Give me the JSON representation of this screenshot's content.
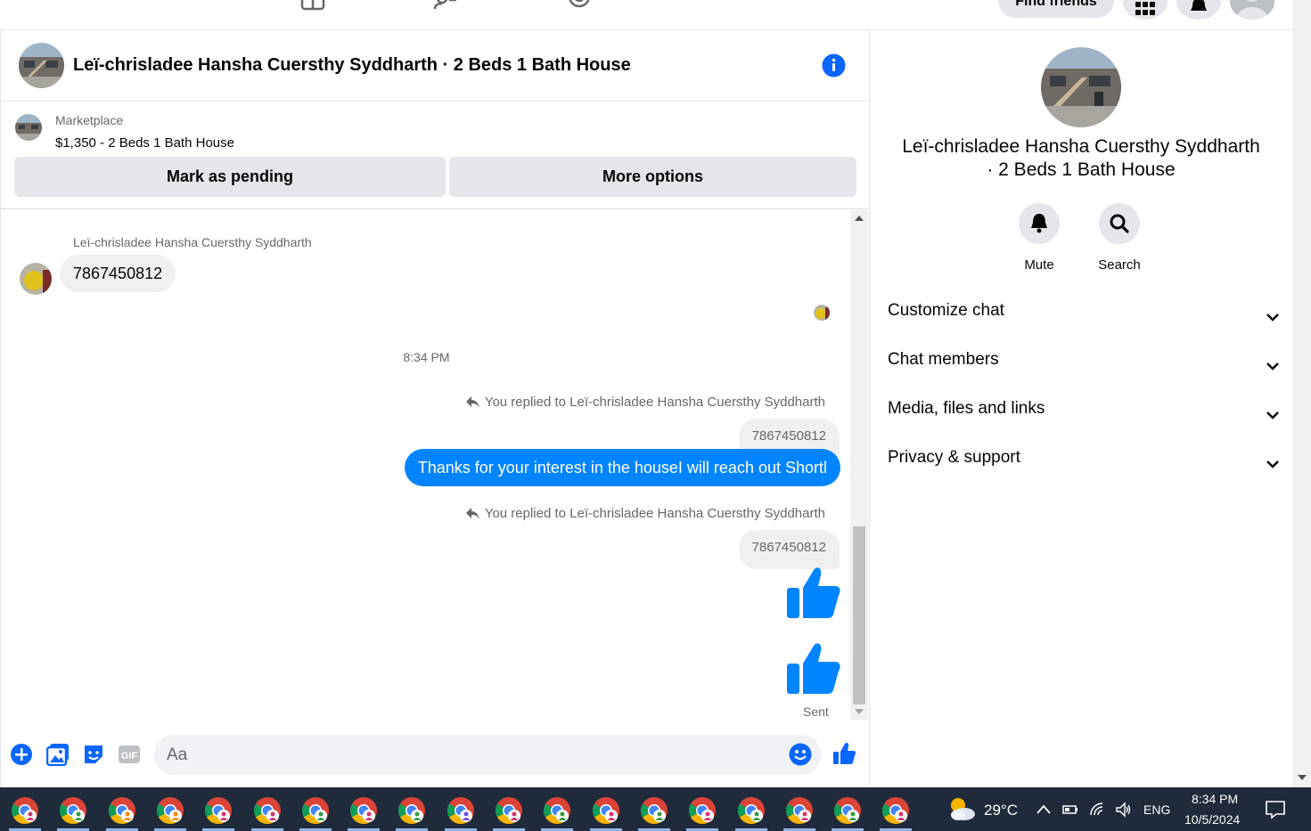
{
  "topbar": {
    "find_friends_label": "Find friends"
  },
  "chat": {
    "title": "Leï-chrisladee Hansha Cuersthy Syddharth · 2 Beds 1 Bath House",
    "marketplace": {
      "label": "Marketplace",
      "listing": "$1,350 - 2 Beds 1 Bath House",
      "mark_pending_label": "Mark as pending",
      "more_options_label": "More options"
    },
    "messages": {
      "sender_name": "Leï-chrisladee Hansha Cuersthy Syddharth",
      "incoming_text": "7867450812",
      "timestamp": "8:34 PM",
      "reply_note_1": "You replied to Leï-chrisladee Hansha Cuersthy Syddharth",
      "reply_quote_1": "7867450812",
      "outgoing_text": "Thanks for your interest in the houseI will reach out Shortl",
      "reply_note_2": "You replied to Leï-chrisladee Hansha Cuersthy Syddharth",
      "reply_quote_2": "7867450812",
      "status": "Sent"
    },
    "composer": {
      "placeholder": "Aa",
      "gif_label": "GIF"
    }
  },
  "sidebar": {
    "title": "Leï-chrisladee Hansha Cuersthy Syddharth · 2 Beds 1 Bath House",
    "mute_label": "Mute",
    "search_label": "Search",
    "sections": [
      {
        "label": "Customize chat"
      },
      {
        "label": "Chat members"
      },
      {
        "label": "Media, files and links"
      },
      {
        "label": "Privacy & support"
      }
    ]
  },
  "taskbar": {
    "weather": "29°C",
    "language": "ENG",
    "time": "8:34 PM",
    "date": "10/5/2024",
    "app_count": 19
  },
  "colors": {
    "accent": "#0084ff",
    "info": "#0866ff",
    "bubble_gray": "#f0f0f0",
    "taskbar": "#1f2b3a"
  }
}
